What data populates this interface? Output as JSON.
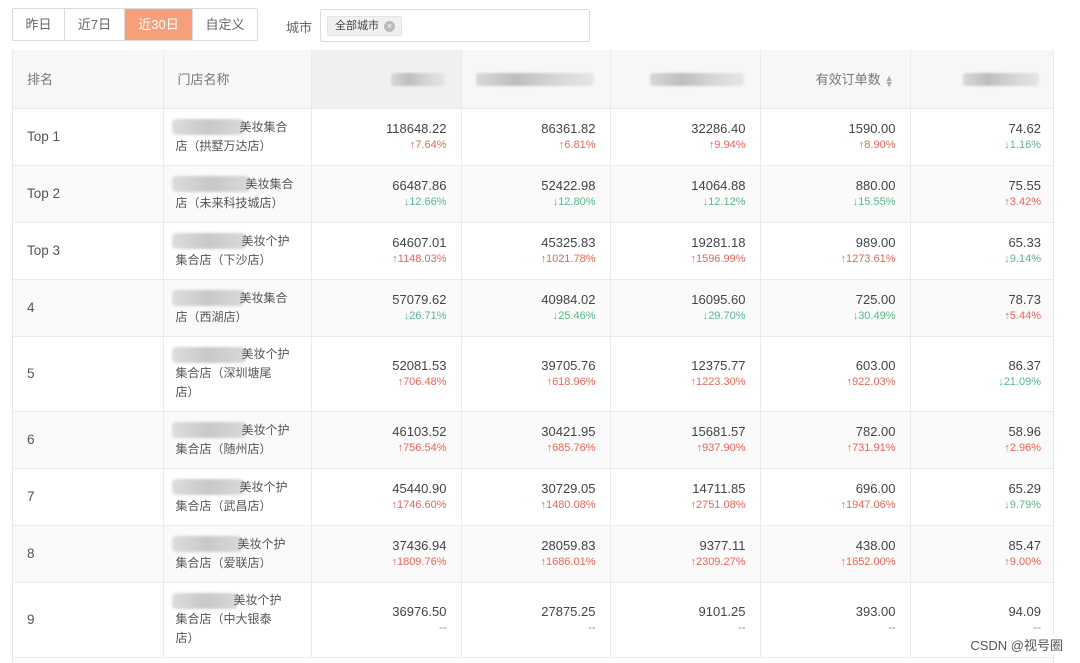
{
  "filters": {
    "ranges": [
      "昨日",
      "近7日",
      "近30日",
      "自定义"
    ],
    "active_range": 2,
    "city_label": "城市",
    "city_tag": "全部城市"
  },
  "table": {
    "headers": {
      "rank": "排名",
      "store": "门店名称",
      "orders": "有效订单数"
    },
    "rows": [
      {
        "rank": "Top 1",
        "store_l1": "美妆集合",
        "store_l2": "店（拱墅万达店）",
        "store_l3": "",
        "v1": "118648.22",
        "c1": "↑7.64%",
        "d1": "up",
        "v2": "86361.82",
        "c2": "↑6.81%",
        "d2": "up",
        "v3": "32286.40",
        "c3": "↑9.94%",
        "d3": "up",
        "v4": "1590.00",
        "c4": "↑8.90%",
        "d4": "up",
        "v5": "74.62",
        "c5": "↓1.16%",
        "d5": "down"
      },
      {
        "rank": "Top 2",
        "store_l1": "美妆集合",
        "store_l2": "店（未来科技城店）",
        "store_l3": "",
        "v1": "66487.86",
        "c1": "↓12.66%",
        "d1": "down",
        "v2": "52422.98",
        "c2": "↓12.80%",
        "d2": "down",
        "v3": "14064.88",
        "c3": "↓12.12%",
        "d3": "down",
        "v4": "880.00",
        "c4": "↓15.55%",
        "d4": "down",
        "v5": "75.55",
        "c5": "↑3.42%",
        "d5": "up"
      },
      {
        "rank": "Top 3",
        "store_l1": "美妆个护",
        "store_l2": "集合店（下沙店）",
        "store_l3": "",
        "v1": "64607.01",
        "c1": "↑1148.03%",
        "d1": "up",
        "v2": "45325.83",
        "c2": "↑1021.78%",
        "d2": "up",
        "v3": "19281.18",
        "c3": "↑1596.99%",
        "d3": "up",
        "v4": "989.00",
        "c4": "↑1273.61%",
        "d4": "up",
        "v5": "65.33",
        "c5": "↓9.14%",
        "d5": "down"
      },
      {
        "rank": "4",
        "store_l1": "美妆集合",
        "store_l2": "店（西湖店）",
        "store_l3": "",
        "v1": "57079.62",
        "c1": "↓26.71%",
        "d1": "down",
        "v2": "40984.02",
        "c2": "↓25.46%",
        "d2": "down",
        "v3": "16095.60",
        "c3": "↓29.70%",
        "d3": "down",
        "v4": "725.00",
        "c4": "↓30.49%",
        "d4": "down",
        "v5": "78.73",
        "c5": "↑5.44%",
        "d5": "up"
      },
      {
        "rank": "5",
        "store_l1": "美妆个护",
        "store_l2": "集合店（深圳塘尾",
        "store_l3": "店）",
        "v1": "52081.53",
        "c1": "↑706.48%",
        "d1": "up",
        "v2": "39705.76",
        "c2": "↑618.96%",
        "d2": "up",
        "v3": "12375.77",
        "c3": "↑1223.30%",
        "d3": "up",
        "v4": "603.00",
        "c4": "↑922.03%",
        "d4": "up",
        "v5": "86.37",
        "c5": "↓21.09%",
        "d5": "down"
      },
      {
        "rank": "6",
        "store_l1": "美妆个护",
        "store_l2": "集合店（随州店）",
        "store_l3": "",
        "v1": "46103.52",
        "c1": "↑756.54%",
        "d1": "up",
        "v2": "30421.95",
        "c2": "↑685.76%",
        "d2": "up",
        "v3": "15681.57",
        "c3": "↑937.90%",
        "d3": "up",
        "v4": "782.00",
        "c4": "↑731.91%",
        "d4": "up",
        "v5": "58.96",
        "c5": "↑2.96%",
        "d5": "up"
      },
      {
        "rank": "7",
        "store_l1": "美妆个护",
        "store_l2": "集合店（武昌店）",
        "store_l3": "",
        "v1": "45440.90",
        "c1": "↑1746.60%",
        "d1": "up",
        "v2": "30729.05",
        "c2": "↑1480.08%",
        "d2": "up",
        "v3": "14711.85",
        "c3": "↑2751.08%",
        "d3": "up",
        "v4": "696.00",
        "c4": "↑1947.06%",
        "d4": "up",
        "v5": "65.29",
        "c5": "↓9.79%",
        "d5": "down"
      },
      {
        "rank": "8",
        "store_l1": "美妆个护",
        "store_l2": "集合店（爱联店）",
        "store_l3": "",
        "v1": "37436.94",
        "c1": "↑1809.76%",
        "d1": "up",
        "v2": "28059.83",
        "c2": "↑1686.01%",
        "d2": "up",
        "v3": "9377.11",
        "c3": "↑2309.27%",
        "d3": "up",
        "v4": "438.00",
        "c4": "↑1652.00%",
        "d4": "up",
        "v5": "85.47",
        "c5": "↑9.00%",
        "d5": "up"
      },
      {
        "rank": "9",
        "store_l1": "美妆个护",
        "store_l2": "集合店（中大银泰",
        "store_l3": "店）",
        "v1": "36976.50",
        "c1": "--",
        "d1": "none",
        "v2": "27875.25",
        "c2": "--",
        "d2": "none",
        "v3": "9101.25",
        "c3": "--",
        "d3": "none",
        "v4": "393.00",
        "c4": "--",
        "d4": "none",
        "v5": "94.09",
        "c5": "--",
        "d5": "none"
      }
    ]
  },
  "watermark": "CSDN @视号圈",
  "colors": {
    "accent": "#f5a07a",
    "up": "#e7685a",
    "down": "#5cb88a"
  }
}
